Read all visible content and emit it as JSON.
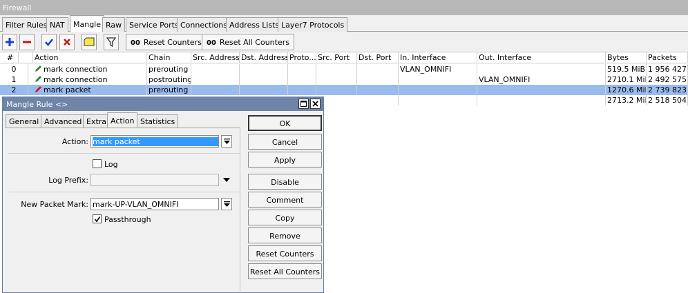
{
  "window": {
    "title": "Firewall"
  },
  "tabs": [
    "Filter Rules",
    "NAT",
    "Mangle",
    "Raw",
    "Service Ports",
    "Connections",
    "Address Lists",
    "Layer7 Protocols"
  ],
  "toolbar": {
    "reset_counters": "Reset Counters",
    "reset_all_counters": "Reset All Counters",
    "oo": "00"
  },
  "table": {
    "columns": [
      "#",
      "",
      "Action",
      "Chain",
      "Src. Address",
      "Dst. Address",
      "Proto...",
      "Src. Port",
      "Dst. Port",
      "In. Interface",
      "Out. Interface",
      "Bytes",
      "Packets"
    ],
    "rows": [
      {
        "num": "0",
        "action": "mark connection",
        "chain": "prerouting",
        "in_interface": "VLAN_OMNIFI",
        "out_interface": "",
        "bytes": "519.5 MiB",
        "packets": "1 956 427"
      },
      {
        "num": "1",
        "action": "mark connection",
        "chain": "postrouting",
        "in_interface": "",
        "out_interface": "VLAN_OMNIFI",
        "bytes": "2710.1 MiB",
        "packets": "2 492 575"
      },
      {
        "num": "2",
        "action": "mark packet",
        "chain": "prerouting",
        "in_interface": "",
        "out_interface": "",
        "bytes": "1270.6 MiB",
        "packets": "2 739 823"
      },
      {
        "num": "",
        "action": "",
        "chain": "",
        "in_interface": "",
        "out_interface": "",
        "bytes": "2713.2 MiB",
        "packets": "2 518 504"
      }
    ]
  },
  "dialog": {
    "title": "Mangle Rule <>",
    "tabs": [
      "General",
      "Advanced",
      "Extra",
      "Action",
      "Statistics"
    ],
    "action_label": "Action:",
    "action_value": "mark packet",
    "log_label": "Log",
    "log_prefix_label": "Log Prefix:",
    "log_prefix_value": "",
    "new_packet_mark_label": "New Packet Mark:",
    "new_packet_mark_value": "mark-UP-VLAN_OMNIFI",
    "passthrough_label": "Passthrough",
    "buttons": [
      "OK",
      "Cancel",
      "Apply",
      "Disable",
      "Comment",
      "Copy",
      "Remove",
      "Reset Counters",
      "Reset All Counters"
    ]
  }
}
